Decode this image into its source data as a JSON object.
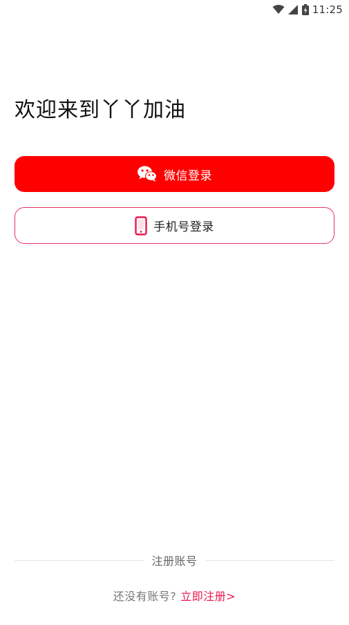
{
  "status_bar": {
    "time": "11:25",
    "icons": [
      "wifi-icon",
      "cellular-signal-icon",
      "battery-charging-icon"
    ]
  },
  "welcome": {
    "title": "欢迎来到丫丫加油"
  },
  "login": {
    "wechat_label": "微信登录",
    "phone_label": "手机号登录"
  },
  "register": {
    "divider_label": "注册账号",
    "prompt": "还没有账号?",
    "link_label": "立即注册>"
  },
  "colors": {
    "primary": "#ff0000",
    "accent": "#e8174d",
    "border": "#e8325f"
  }
}
